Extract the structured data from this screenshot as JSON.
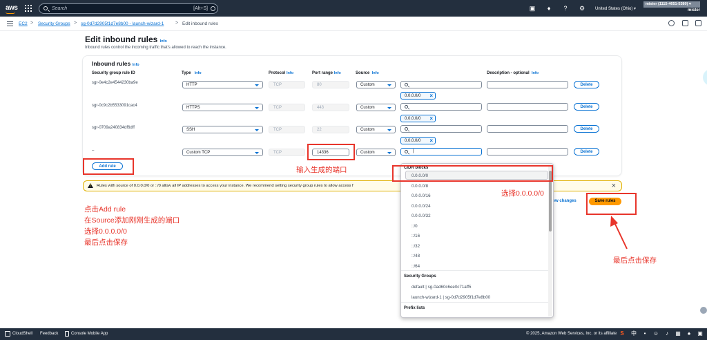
{
  "topnav": {
    "logo": "aws",
    "search_placeholder": "Search",
    "search_shortcut": "[Alt+S]",
    "region": "United States (Ohio) ▾",
    "account": "mister (1115-4651-5380) ▾",
    "user": "mister",
    "icons": [
      "services-grid-icon",
      "search-icon",
      "cloudshell-icon",
      "bell-icon",
      "help-icon",
      "settings-icon"
    ]
  },
  "breadcrumb": {
    "items": [
      "EC2",
      "Security Groups",
      "sg-0d7d2905f1d7e8b00 - launch-wizard-1"
    ],
    "current": "Edit inbound rules",
    "separator": ">"
  },
  "page": {
    "title": "Edit inbound rules",
    "info": "Info",
    "description": "Inbound rules control the incoming traffic that's allowed to reach the instance."
  },
  "inbound": {
    "title": "Inbound rules",
    "info": "Info",
    "headers": {
      "rule_id": "Security group rule ID",
      "type": "Type",
      "type_info": "Info",
      "protocol": "Protocol",
      "protocol_info": "Info",
      "port_range": "Port range",
      "port_info": "Info",
      "source": "Source",
      "source_info": "Info",
      "description": "Description - optional",
      "description_info": "Info"
    },
    "rules": [
      {
        "id": "sgr-0e4c2e4544230ba9e",
        "type": "HTTP",
        "protocol": "TCP",
        "port": "80",
        "source": "Custom",
        "token": "0.0.0.0/0",
        "delete": "Delete"
      },
      {
        "id": "sgr-0c9c2b5533091cac4",
        "type": "HTTPS",
        "protocol": "TCP",
        "port": "443",
        "source": "Custom",
        "token": "0.0.0.0/0",
        "delete": "Delete"
      },
      {
        "id": "sgr-0709a240834df6dff",
        "type": "SSH",
        "protocol": "TCP",
        "port": "22",
        "source": "Custom",
        "token": "0.0.0.0/0",
        "delete": "Delete"
      },
      {
        "id": "–",
        "type": "Custom TCP",
        "protocol": "TCP",
        "port": "14336",
        "source": "Custom",
        "token": "",
        "search_value": "|",
        "delete": "Delete"
      }
    ],
    "add_rule": "Add rule"
  },
  "alert": {
    "text": "Rules with source of 0.0.0.0/0 or ::/0 allow all IP addresses to access your instance. We recommend setting security group rules to allow access f"
  },
  "actions": {
    "preview": "iew changes",
    "save": "Save rules"
  },
  "dropdown": {
    "cidr_header": "CIDR blocks",
    "cidr": [
      "0.0.0.0/0",
      "0.0.0.0/8",
      "0.0.0.0/16",
      "0.0.0.0/24",
      "0.0.0.0/32",
      "::/0",
      "::/16",
      "::/32",
      "::/48",
      "::/64"
    ],
    "sg_header": "Security Groups",
    "security_groups": [
      "default | sg-0ad60c6ee0c71aff5",
      "launch-wizard-1 | sg-0d7d2905f1d7e8b00"
    ],
    "prefix_header": "Prefix lists"
  },
  "annotations": {
    "port_note": "输入生成的端口",
    "select_note": "选择0.0.0.0/0",
    "steps": [
      "点击Add rule",
      "在Source添加刚刚生成的端口",
      "选择0.0.0.0/0",
      "最后点击保存"
    ],
    "save_note": "最后点击保存",
    "color": "#e8352b"
  },
  "footer": {
    "cloudshell": "CloudShell",
    "feedback": "Feedback",
    "mobile": "Console Mobile App",
    "copyright": "© 2025, Amazon Web Services, Inc. or its affiliate",
    "tray": [
      "中"
    ]
  }
}
